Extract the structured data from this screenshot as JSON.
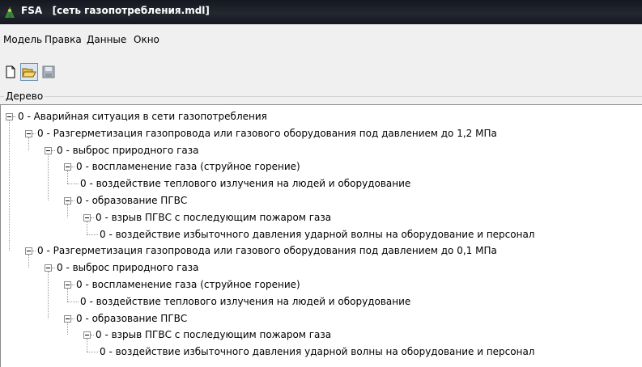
{
  "window": {
    "title": "FSA   [сеть газопотребления.mdl]"
  },
  "menu": [
    "Модель",
    "Правка",
    "Данные",
    "Окно"
  ],
  "toolbar": {
    "buttons": [
      "new-document-icon",
      "open-folder-icon",
      "save-disk-icon"
    ]
  },
  "tree_group": {
    "label": "Дерево"
  },
  "tree": [
    {
      "level": 0,
      "text": "0 - Аварийная ситуация в сети газопотребления",
      "expander": true
    },
    {
      "level": 1,
      "text": "0 - Разгерметизация газопровода или газового оборудования под давлением до 1,2 МПа",
      "expander": true
    },
    {
      "level": 2,
      "text": "0 - выброс природного газа",
      "expander": true
    },
    {
      "level": 3,
      "text": "0 - воспламенение газа (струйное горение)",
      "expander": true
    },
    {
      "level": 4,
      "text": "0 - воздействие теплового излучения на людей и оборудование",
      "expander": false
    },
    {
      "level": 3,
      "text": "0 - образование ПГВС",
      "expander": true
    },
    {
      "level": 4,
      "text": "0 - взрыв ПГВС с последующим пожаром газа",
      "expander": true
    },
    {
      "level": 5,
      "text": "0 - воздействие избыточного давления ударной волны на оборудование и персонал",
      "expander": false
    },
    {
      "level": 1,
      "text": "0 - Разгерметизация газопровода или газового оборудования под давлением до 0,1 МПа",
      "expander": true
    },
    {
      "level": 2,
      "text": "0 - выброс природного газа",
      "expander": true
    },
    {
      "level": 3,
      "text": "0 - воспламенение газа (струйное горение)",
      "expander": true
    },
    {
      "level": 4,
      "text": "0 - воздействие теплового излучения на людей и оборудование",
      "expander": false
    },
    {
      "level": 3,
      "text": "0 - образование ПГВС",
      "expander": true
    },
    {
      "level": 4,
      "text": "0 - взрыв ПГВС с последующим пожаром газа",
      "expander": true
    },
    {
      "level": 5,
      "text": "0 - воздействие избыточного давления ударной волны на оборудование и персонал",
      "expander": false
    }
  ]
}
